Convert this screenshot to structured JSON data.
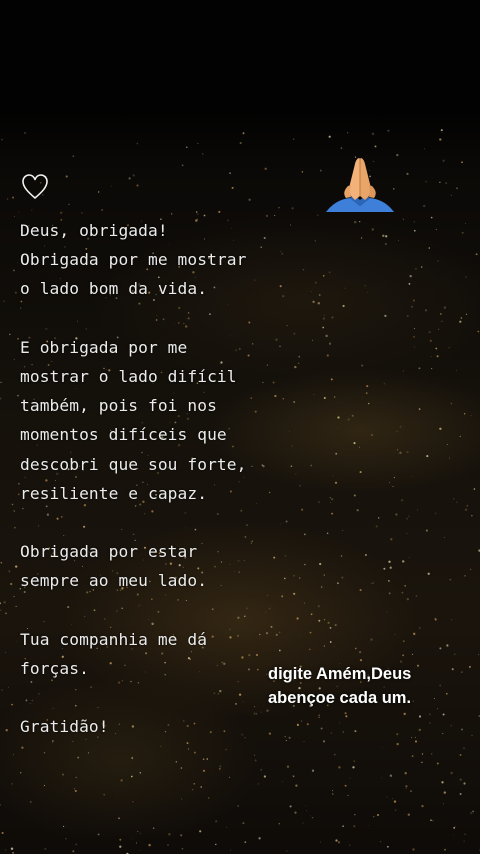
{
  "story": {
    "message": "Deus, obrigada!\nObrigada por me mostrar\no lado bom da vida.\n\nE obrigada por me\nmostrar o lado difícil\ntambém, pois foi nos\nmomentos difíceis que\ndescobri que sou forte,\nresiliente e capaz.\n\nObrigada por estar\nsempre ao meu lado.\n\nTua companhia me dá\nforças.\n\nGratidão!",
    "call_to_action": "digite Amém,Deus\nabençoe cada um.",
    "heart_icon": "heart-outline-icon",
    "emoji_icon": "folded-hands-icon"
  },
  "colors": {
    "text": "#ececec",
    "overlay_text": "#ffffff",
    "background": "#050505",
    "emoji_sleeve": "#3d7fd9",
    "emoji_skin": "#f2b27a"
  }
}
